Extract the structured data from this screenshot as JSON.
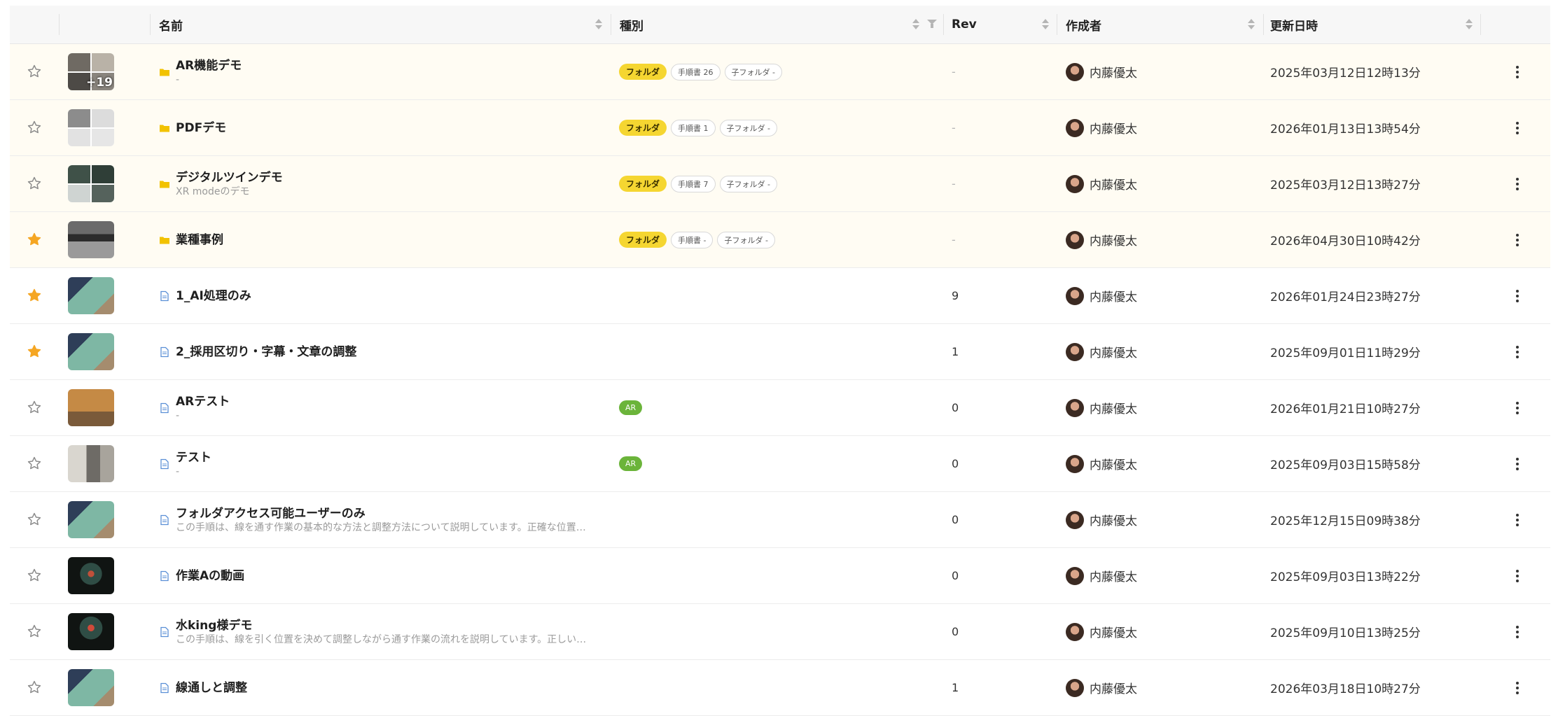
{
  "header": {
    "name": "名前",
    "kind": "種別",
    "rev": "Rev",
    "creator": "作成者",
    "updated": "更新日時"
  },
  "colors": {
    "folder_pill": "#f5d631",
    "ar_pill": "#6bb43a",
    "star_filled": "#f5a623",
    "folder_icon": "#f2c200",
    "doc_icon": "#5a8fd6"
  },
  "rows": [
    {
      "type": "folder",
      "starred": false,
      "title": "AR機能デモ",
      "subtitle": "-",
      "folder_label": "フォルダ",
      "tag1": "手順書 26",
      "tag2": "子フォルダ -",
      "rev": "-",
      "author": "内藤優太",
      "date": "2025年03月12日12時13分",
      "thumb_extra": "+19"
    },
    {
      "type": "folder",
      "starred": false,
      "title": "PDFデモ",
      "subtitle": "",
      "folder_label": "フォルダ",
      "tag1": "手順書 1",
      "tag2": "子フォルダ -",
      "rev": "-",
      "author": "内藤優太",
      "date": "2026年01月13日13時54分"
    },
    {
      "type": "folder",
      "starred": false,
      "title": "デジタルツインデモ",
      "subtitle": "XR modeのデモ",
      "folder_label": "フォルダ",
      "tag1": "手順書 7",
      "tag2": "子フォルダ -",
      "rev": "-",
      "author": "内藤優太",
      "date": "2025年03月12日13時27分"
    },
    {
      "type": "folder",
      "starred": true,
      "title": "業種事例",
      "subtitle": "",
      "folder_label": "フォルダ",
      "tag1": "手順書 -",
      "tag2": "子フォルダ -",
      "rev": "-",
      "author": "内藤優太",
      "date": "2026年04月30日10時42分"
    },
    {
      "type": "doc",
      "starred": true,
      "title": "1_AI処理のみ",
      "subtitle": "",
      "rev": "9",
      "author": "内藤優太",
      "date": "2026年01月24日23時27分"
    },
    {
      "type": "doc",
      "starred": true,
      "title": "2_採用区切り・字幕・文章の調整",
      "subtitle": "",
      "rev": "1",
      "author": "内藤優太",
      "date": "2025年09月01日11時29分"
    },
    {
      "type": "doc",
      "starred": false,
      "title": "ARテスト",
      "subtitle": "-",
      "ar_label": "AR",
      "rev": "0",
      "author": "内藤優太",
      "date": "2026年01月21日10時27分"
    },
    {
      "type": "doc",
      "starred": false,
      "title": "テスト",
      "subtitle": "-",
      "ar_label": "AR",
      "rev": "0",
      "author": "内藤優太",
      "date": "2025年09月03日15時58分"
    },
    {
      "type": "doc",
      "starred": false,
      "title": "フォルダアクセス可能ユーザーのみ",
      "subtitle": "この手順は、線を通す作業の基本的な方法と調整方法について説明しています。正確な位置…",
      "rev": "0",
      "author": "内藤優太",
      "date": "2025年12月15日09時38分"
    },
    {
      "type": "doc",
      "starred": false,
      "title": "作業Aの動画",
      "subtitle": "",
      "rev": "0",
      "author": "内藤優太",
      "date": "2025年09月03日13時22分"
    },
    {
      "type": "doc",
      "starred": false,
      "title": "水king様デモ",
      "subtitle": "この手順は、線を引く位置を決めて調整しながら通す作業の流れを説明しています。正しい…",
      "rev": "0",
      "author": "内藤優太",
      "date": "2025年09月10日13時25分"
    },
    {
      "type": "doc",
      "starred": false,
      "title": "線通しと調整",
      "subtitle": "",
      "rev": "1",
      "author": "内藤優太",
      "date": "2026年03月18日10時27分"
    }
  ]
}
